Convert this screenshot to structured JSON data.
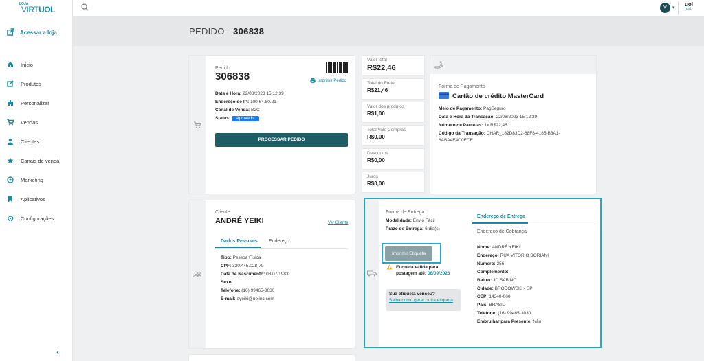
{
  "brand": {
    "loja": "LOJA",
    "name_light": "VIRT",
    "name_bold": "UOL",
    "host_logo": "uol",
    "host_sub": "host"
  },
  "colors": {
    "accent": "#1b8aa0",
    "primary_button": "#1e5d66",
    "badge": "#1e7ce6",
    "highlight_border": "#28a7c8"
  },
  "sidebar": {
    "access_label": "Acessar a loja",
    "items": [
      {
        "label": "Início",
        "icon": "home-icon"
      },
      {
        "label": "Produtos",
        "icon": "edit-icon"
      },
      {
        "label": "Personalizar",
        "icon": "puzzle-icon"
      },
      {
        "label": "Vendas",
        "icon": "cart-icon"
      },
      {
        "label": "Clientes",
        "icon": "user-icon"
      },
      {
        "label": "Canais de venda",
        "icon": "star-icon"
      },
      {
        "label": "Marketing",
        "icon": "target-icon"
      },
      {
        "label": "Aplicativos",
        "icon": "bookmark-icon"
      },
      {
        "label": "Configurações",
        "icon": "gear-icon"
      }
    ],
    "collapse_glyph": "‹"
  },
  "topbar": {
    "avatar_letter": "V"
  },
  "page": {
    "title_prefix": "PEDIDO - ",
    "title_number": "306838"
  },
  "order": {
    "label": "Pedido",
    "number": "306838",
    "print_label": "Imprimir Pedido",
    "date_label": "Data e Hora:",
    "date_value": "22/08/2023 15:12:39",
    "ip_label": "Endereço de IP:",
    "ip_value": "100.64.80.21",
    "channel_label": "Canal de Venda:",
    "channel_value": "B2C",
    "status_label": "Status:",
    "status_value": "Aprovado",
    "process_button": "PROCESSAR PEDIDO"
  },
  "totals": [
    {
      "label": "Valor total",
      "value": "R$22,46"
    },
    {
      "label": "Total do Frete",
      "value": "R$21,46"
    },
    {
      "label": "Valor dos produtos",
      "value": "R$1,00"
    },
    {
      "label": "Total Vale Compras",
      "value": "R$0,00"
    },
    {
      "label": "Descontos",
      "value": "R$0,00"
    },
    {
      "label": "Juros",
      "value": "R$0,00"
    }
  ],
  "payment": {
    "label": "Forma de Pagamento",
    "method": "Cartão de crédito MasterCard",
    "means_label": "Meio de Pagamento:",
    "means_value": "PagSeguro",
    "date_label": "Data e Hora da Transação:",
    "date_value": "22/08/2023 15:12:39",
    "installments_label": "Número de Parcelas:",
    "installments_value": "1x R$22,46",
    "code_label": "Código da Transação:",
    "code_value": "CHAR_182D83D2-88F8-4185-B3A1-",
    "code_value_2": "8ABA4E4C0ECE"
  },
  "client": {
    "label": "Cliente",
    "name": "ANDRÉ YEIKI",
    "view_link": "Ver Cliente",
    "tabs": [
      "Dados Pessoais",
      "Endereço"
    ],
    "type_label": "Tipo:",
    "type_value": "Pessoa Física",
    "cpf_label": "CPF:",
    "cpf_value": "320.445.028-79",
    "birth_label": "Data de Nascimento:",
    "birth_value": "08/07/1983",
    "sex_label": "Sexo:",
    "sex_value": "",
    "phone_label": "Telefone:",
    "phone_value": "(16) 99465-3030",
    "email_label": "E-mail:",
    "email_value": "ayeiki@uolinc.com"
  },
  "delivery": {
    "label": "Forma de Entrega",
    "mode_label": "Modalidade:",
    "mode_value": "Envio Fácil",
    "term_label": "Prazo de Entrega:",
    "term_value": "6 dia(s)",
    "print_label_button": "Imprimir Etiqueta",
    "valid_text_1": "Etiqueta válida para",
    "valid_text_2": "postagem até:",
    "valid_date": "06/09/2023",
    "expired_q": "Sua etiqueta venceu?",
    "expired_link": "Saiba como gerar outra etiqueta",
    "tabs": [
      "Endereço de Entrega",
      "Endereço de Cobrança"
    ],
    "fields": [
      {
        "label": "Nome:",
        "value": "ANDRÉ YEIKI"
      },
      {
        "label": "Endereço:",
        "value": "RUA VITÓRIO SORIANI"
      },
      {
        "label": "Numero:",
        "value": "256"
      },
      {
        "label": "Complemento:",
        "value": ""
      },
      {
        "label": "Bairro:",
        "value": "JD SABINO"
      },
      {
        "label": "Cidade:",
        "value": "BRODOWSKI - SP"
      },
      {
        "label": "CEP:",
        "value": "14340-000"
      },
      {
        "label": "País:",
        "value": "BRASIL"
      },
      {
        "label": "Telefone:",
        "value": "(16) 99465-3030"
      },
      {
        "label": "Embrulhar para Presente:",
        "value": "Não"
      }
    ]
  }
}
